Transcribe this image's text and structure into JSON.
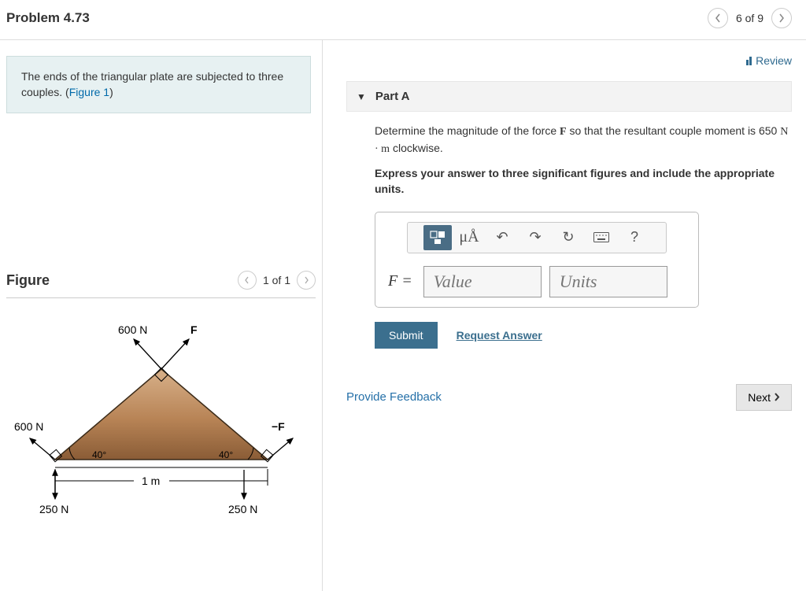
{
  "header": {
    "title": "Problem 4.73",
    "nav_count": "6 of 9"
  },
  "problem": {
    "description_prefix": "The ends of the triangular plate are subjected to three couples. (",
    "figure_ref": "Figure 1",
    "description_suffix": ")"
  },
  "figure": {
    "title": "Figure",
    "count": "1 of 1",
    "labels": {
      "top_left": "600 N",
      "top_F": "F",
      "left_600": "600 N",
      "right_F": "−F",
      "angle_left": "40°",
      "angle_right": "40°",
      "bottom_span": "1 m",
      "bottom_left": "250 N",
      "bottom_right": "250 N"
    }
  },
  "review": {
    "label": "Review"
  },
  "partA": {
    "title": "Part A",
    "question_pre": "Determine the magnitude of the force ",
    "question_F": "F",
    "question_mid": " so that the resultant couple moment is 650 ",
    "question_units": "N · m",
    "question_post": " clockwise.",
    "instruction": "Express your answer to three significant figures and include the appropriate units.",
    "var_label": "F =",
    "value_placeholder": "Value",
    "units_placeholder": "Units",
    "submit": "Submit",
    "request": "Request Answer"
  },
  "toolbar": {
    "template_icon": "⬚▮",
    "mu": "μÅ",
    "undo": "↶",
    "redo": "↷",
    "reset": "↻",
    "keyboard": "⌨",
    "help": "?"
  },
  "footer": {
    "feedback": "Provide Feedback",
    "next": "Next"
  }
}
